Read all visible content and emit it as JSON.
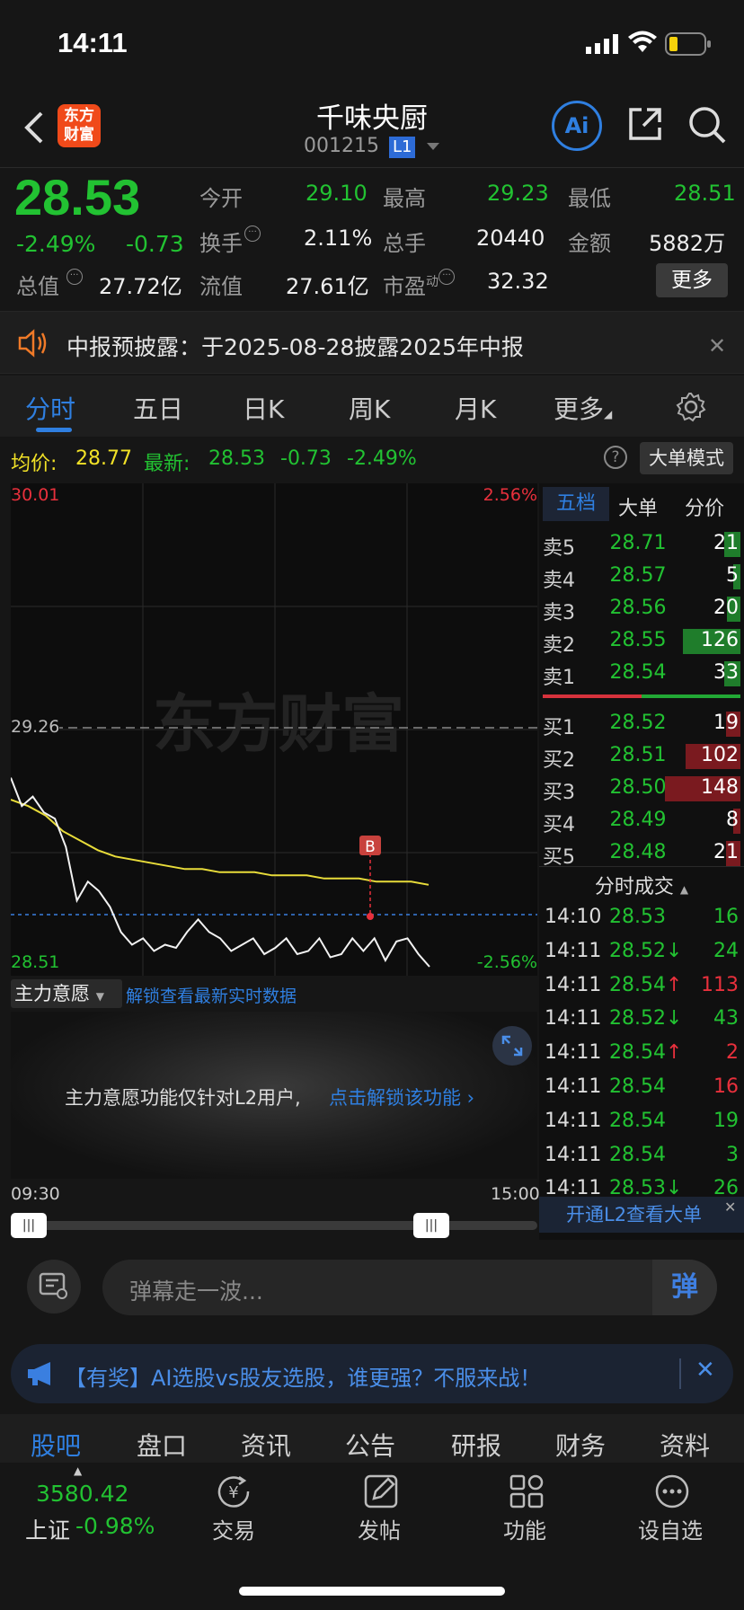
{
  "status": {
    "time": "14:11"
  },
  "nav": {
    "title": "千味央厨",
    "code": "001215",
    "level_badge": "L1",
    "logo_line1": "东方",
    "logo_line2": "财富",
    "ai_label": "Ai"
  },
  "quote": {
    "price": "28.53",
    "change_pct": "-2.49%",
    "change": "-0.73",
    "open_label": "今开",
    "open": "29.10",
    "high_label": "最高",
    "high": "29.23",
    "low_label": "最低",
    "low": "28.51",
    "turnover_label": "换手",
    "turnover": "2.11%",
    "volume_label": "总手",
    "volume": "20440",
    "amount_label": "金额",
    "amount": "5882万",
    "mktcap_label": "总值",
    "mktcap": "27.72亿",
    "float_label": "流值",
    "float": "27.61亿",
    "pe_label": "市盈",
    "pe_sup": "动",
    "pe": "32.32",
    "more_label": "更多"
  },
  "notice": {
    "text": "中报预披露：于2025-08-28披露2025年中报"
  },
  "tabs": [
    "分时",
    "五日",
    "日K",
    "周K",
    "月K",
    "更多"
  ],
  "info": {
    "avg_label": "均价:",
    "avg": "28.77",
    "latest_label": "最新:",
    "latest": "28.53",
    "change": "-0.73",
    "pct": "-2.49%",
    "mode_btn": "大单模式"
  },
  "chart": {
    "top_price": "30.01",
    "top_pct": "2.56%",
    "mid_price": "29.26",
    "bottom_price": "28.51",
    "bottom_pct": "-2.56%",
    "watermark": "东方财富",
    "marker": "B",
    "time_start": "09:30",
    "time_end": "15:00"
  },
  "chart_data": {
    "type": "line",
    "ylim": [
      28.51,
      30.01
    ],
    "prev_close": 29.26,
    "current_price": 28.53,
    "series": [
      {
        "values": [
          29.11,
          29.02,
          29.05,
          29.0,
          28.98,
          28.89,
          28.72,
          28.78,
          28.75,
          28.7,
          28.62,
          28.58,
          28.6,
          28.56,
          28.58,
          28.57,
          28.62,
          28.66,
          28.62,
          28.6,
          28.56,
          28.58,
          28.6,
          28.55,
          28.57,
          28.6,
          28.55,
          28.56,
          28.6,
          28.54,
          28.55,
          28.6,
          28.56,
          28.6,
          28.53,
          28.59,
          28.6,
          28.55,
          28.51
        ]
      },
      {
        "values": [
          29.04,
          29.02,
          28.99,
          28.94,
          28.91,
          28.88,
          28.86,
          28.85,
          28.84,
          28.83,
          28.82,
          28.82,
          28.81,
          28.81,
          28.81,
          28.8,
          28.8,
          28.8,
          28.79,
          28.79,
          28.79,
          28.78,
          28.78,
          28.78,
          28.77
        ]
      }
    ]
  },
  "mainforce": {
    "label": "主力意愿",
    "unlock_link": "解锁查看最新实时数据",
    "message": "主力意愿功能仅针对L2用户,",
    "message_link": "点击解锁该功能"
  },
  "orderbook": {
    "tabs": [
      "五档",
      "大单",
      "分价"
    ],
    "asks": [
      {
        "label": "卖5",
        "price": "28.71",
        "vol": "21",
        "level": 0.15
      },
      {
        "label": "卖4",
        "price": "28.57",
        "vol": "5",
        "level": 0.0
      },
      {
        "label": "卖3",
        "price": "28.56",
        "vol": "20",
        "level": 0.1
      },
      {
        "label": "卖2",
        "price": "28.55",
        "vol": "126",
        "level": 0.85
      },
      {
        "label": "卖1",
        "price": "28.54",
        "vol": "33",
        "level": 0.15
      }
    ],
    "bids": [
      {
        "label": "买1",
        "price": "28.52",
        "vol": "19",
        "level": 0.1
      },
      {
        "label": "买2",
        "price": "28.51",
        "vol": "102",
        "level": 0.7
      },
      {
        "label": "买3",
        "price": "28.50",
        "vol": "148",
        "level": 1.0
      },
      {
        "label": "买4",
        "price": "28.49",
        "vol": "8",
        "level": 0.0
      },
      {
        "label": "买5",
        "price": "28.48",
        "vol": "21",
        "level": 0.1
      }
    ],
    "trades_title": "分时成交",
    "trades": [
      {
        "t": "14:10",
        "p": "28.53",
        "a": "",
        "v": "16",
        "c": "green"
      },
      {
        "t": "14:11",
        "p": "28.52",
        "a": "↓",
        "v": "24",
        "c": "green"
      },
      {
        "t": "14:11",
        "p": "28.54",
        "a": "↑",
        "v": "113",
        "c": "red"
      },
      {
        "t": "14:11",
        "p": "28.52",
        "a": "↓",
        "v": "43",
        "c": "green"
      },
      {
        "t": "14:11",
        "p": "28.54",
        "a": "↑",
        "v": "2",
        "c": "red"
      },
      {
        "t": "14:11",
        "p": "28.54",
        "a": "",
        "v": "16",
        "c": "red"
      },
      {
        "t": "14:11",
        "p": "28.54",
        "a": "",
        "v": "19",
        "c": "green"
      },
      {
        "t": "14:11",
        "p": "28.54",
        "a": "",
        "v": "3",
        "c": "green"
      },
      {
        "t": "14:11",
        "p": "28.53",
        "a": "↓",
        "v": "26",
        "c": "green"
      }
    ],
    "l2_banner": "开通L2查看大单"
  },
  "danmaku": {
    "placeholder": "弹幕走一波...",
    "send": "弹"
  },
  "promo": {
    "text": "【有奖】AI选股vs股友选股，谁更强？不服来战！"
  },
  "subtabs": [
    "股吧",
    "盘口",
    "资讯",
    "公告",
    "研报",
    "财务",
    "资料"
  ],
  "bottom": {
    "index_value": "3580.42",
    "index_name": "上证",
    "index_pct": "-0.98%",
    "trade": "交易",
    "post": "发帖",
    "func": "功能",
    "watch": "设自选"
  }
}
